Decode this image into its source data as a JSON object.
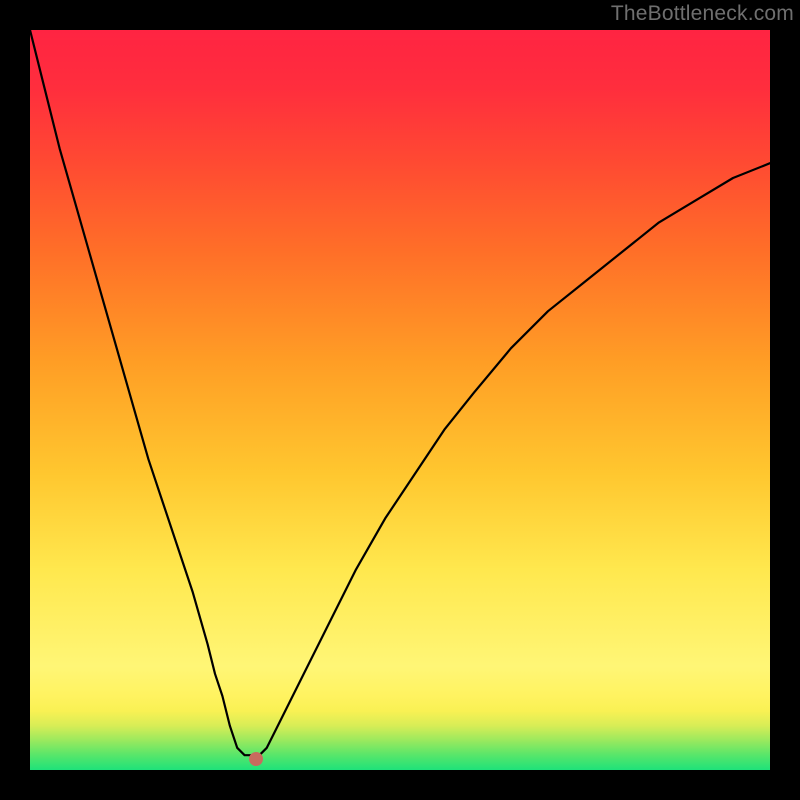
{
  "watermark": "TheBottleneck.com",
  "chart_data": {
    "type": "line",
    "title": "",
    "xlabel": "",
    "ylabel": "",
    "xlim": [
      0,
      100
    ],
    "ylim": [
      0,
      100
    ],
    "grid": false,
    "series": [
      {
        "name": "curve",
        "x": [
          0,
          2,
          4,
          6,
          8,
          10,
          12,
          14,
          16,
          18,
          20,
          22,
          24,
          25,
          26,
          27,
          28,
          29,
          30,
          31,
          32,
          33,
          35,
          37,
          40,
          44,
          48,
          52,
          56,
          60,
          65,
          70,
          75,
          80,
          85,
          90,
          95,
          100
        ],
        "y": [
          100,
          92,
          84,
          77,
          70,
          63,
          56,
          49,
          42,
          36,
          30,
          24,
          17,
          13,
          10,
          6,
          3,
          2,
          2,
          2,
          3,
          5,
          9,
          13,
          19,
          27,
          34,
          40,
          46,
          51,
          57,
          62,
          66,
          70,
          74,
          77,
          80,
          82
        ]
      }
    ],
    "marker": {
      "x": 30.5,
      "y": 1.5,
      "color": "#c96b5e"
    }
  }
}
